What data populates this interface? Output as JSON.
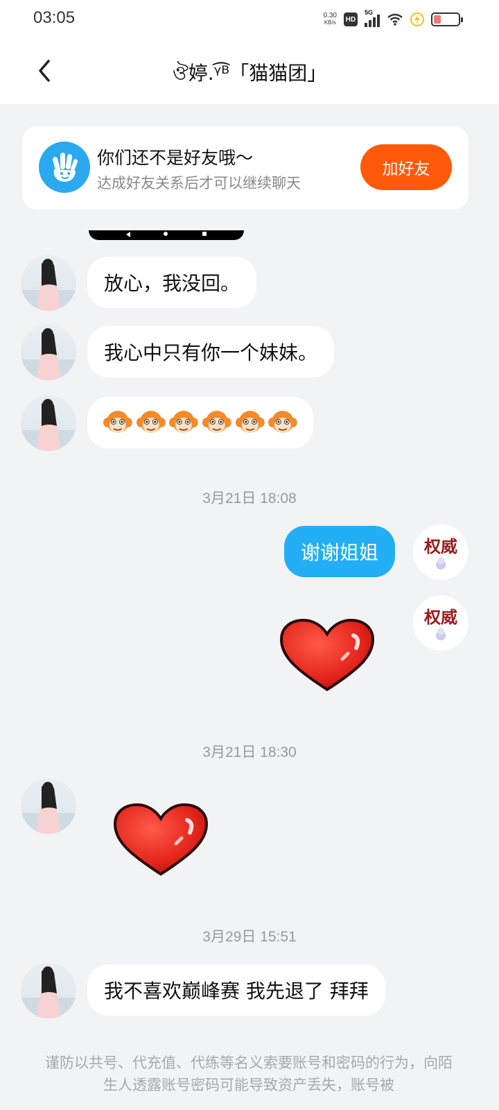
{
  "status_bar": {
    "time": "03:05",
    "net_speed_value": "0.30",
    "net_speed_unit": "KB/s",
    "hd_label": "HD",
    "signal_label": "5G",
    "battery_level": 0.3
  },
  "header": {
    "back_icon": "chevron-left-icon",
    "title": "ঔ婷.ᵞ͡ᴮ「猫猫团」"
  },
  "friend_notice": {
    "icon": "waving-hand-icon",
    "title": "你们还不是好友哦～",
    "subtitle": "达成好友关系后才可以继续聊天",
    "button_label": "加好友"
  },
  "messages": [
    {
      "from": "them",
      "type": "text",
      "text": "放心，我没回。"
    },
    {
      "from": "them",
      "type": "text",
      "text": "我心中只有你一个妹妹。"
    },
    {
      "from": "them",
      "type": "emoji_row",
      "emojis": [
        "monkey-emoji",
        "monkey-emoji",
        "monkey-emoji",
        "monkey-emoji",
        "monkey-emoji",
        "monkey-emoji"
      ]
    },
    {
      "type": "timestamp",
      "text": "3月21日 18:08"
    },
    {
      "from": "me",
      "type": "text",
      "text": "谢谢姐姐"
    },
    {
      "from": "me",
      "type": "sticker",
      "sticker": "red-heart-sticker"
    },
    {
      "type": "timestamp",
      "text": "3月21日 18:30"
    },
    {
      "from": "them",
      "type": "sticker",
      "sticker": "red-heart-sticker"
    },
    {
      "type": "timestamp",
      "text": "3月29日 15:51"
    },
    {
      "from": "them",
      "type": "text",
      "text": "我不喜欢巅峰赛 我先退了 拜拜"
    }
  ],
  "my_avatar_text": "权威",
  "colors": {
    "accent_blue": "#23aef6",
    "add_friend_orange": "#ff5a0a",
    "background": "#f2f3f5"
  },
  "warning": "谨防以共号、代充值、代练等名义索要账号和密码的行为，向陌生人透露账号密码可能导致资产丢失，账号被"
}
